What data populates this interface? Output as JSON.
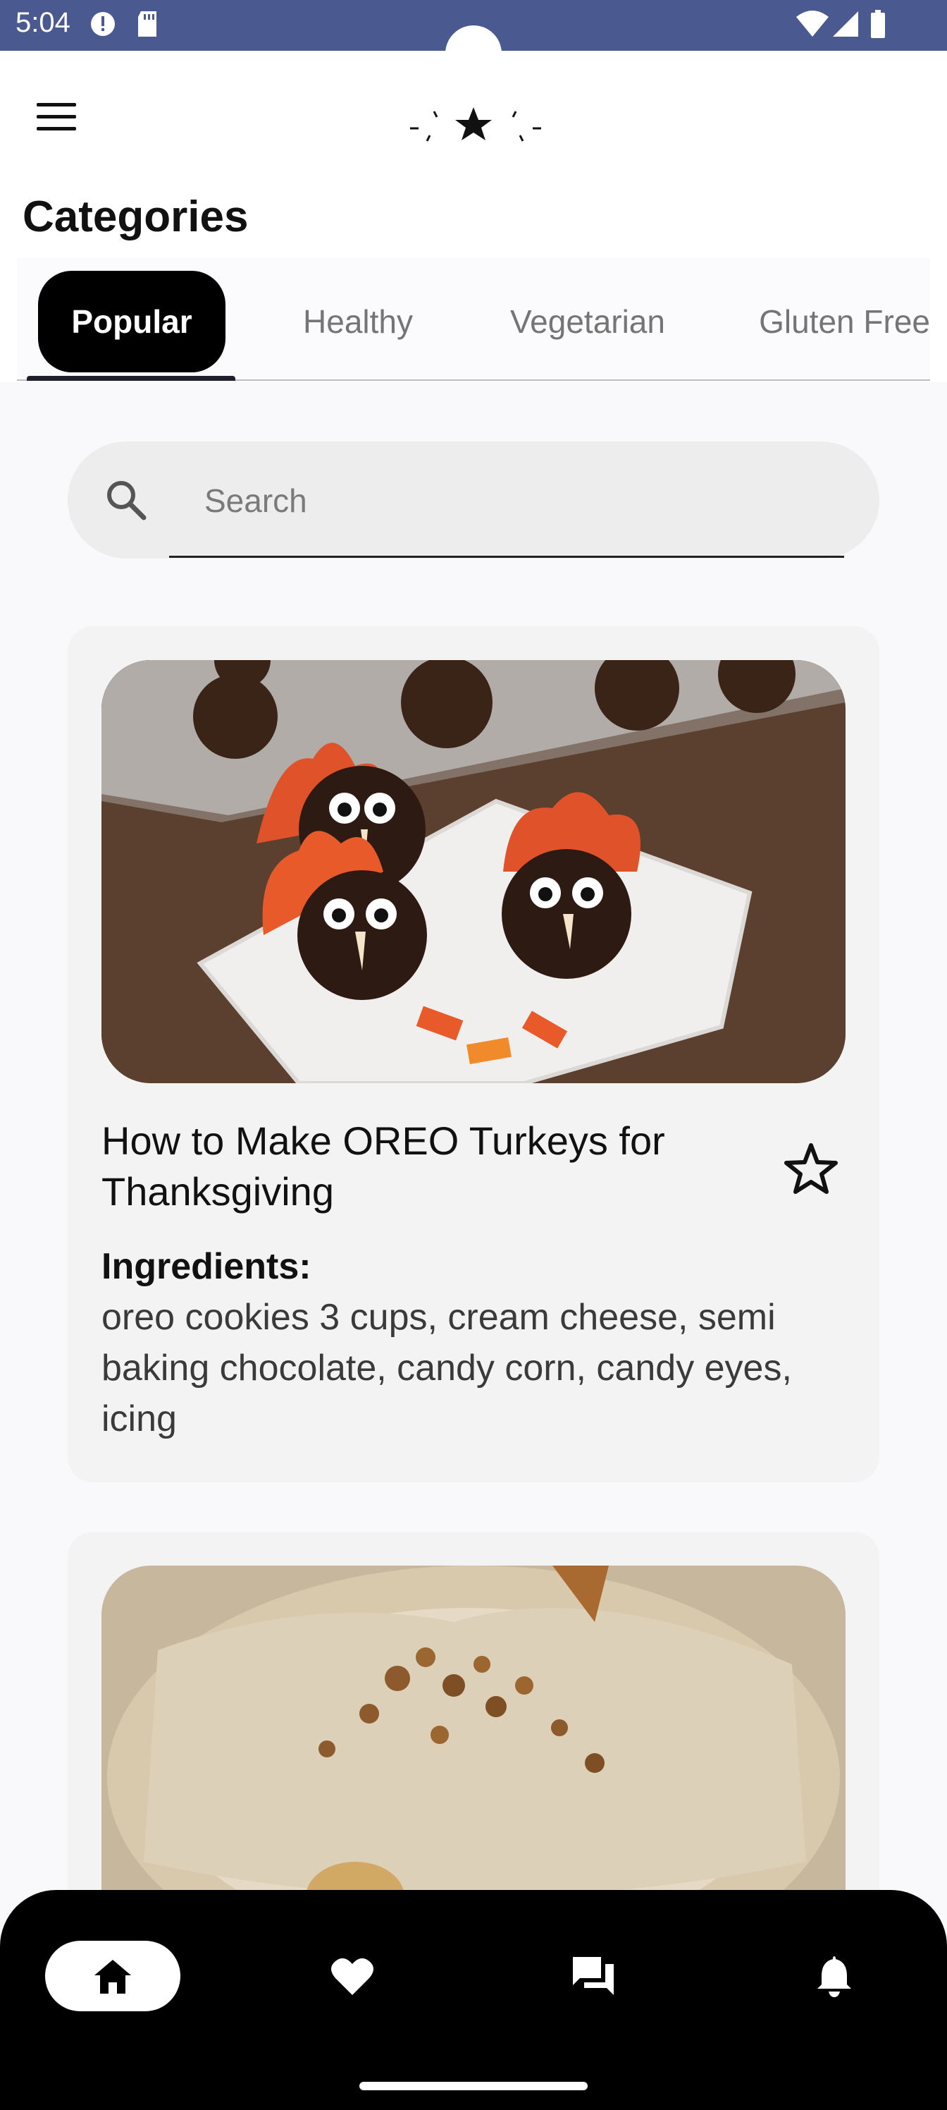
{
  "status_bar": {
    "time": "5:04",
    "icons": [
      "alert-icon",
      "sd-card-icon",
      "wifi-icon",
      "signal-icon",
      "battery-icon"
    ],
    "background": "#4A5A91"
  },
  "header": {
    "menu_icon": "hamburger-menu-icon",
    "logo_icon": "sparkle-star-logo-icon"
  },
  "categories": {
    "title": "Categories",
    "tabs": [
      {
        "label": "Popular",
        "active": true
      },
      {
        "label": "Healthy",
        "active": false
      },
      {
        "label": "Vegetarian",
        "active": false
      },
      {
        "label": "Gluten Free",
        "active": false
      }
    ]
  },
  "search": {
    "placeholder": "Search",
    "value": ""
  },
  "recipes": [
    {
      "title": "How to Make OREO Turkeys for Thanksgiving",
      "ingredients_label": "Ingredients:",
      "ingredients": "oreo cookies 3 cups, cream cheese, semi baking chocolate, candy corn, candy eyes, icing",
      "favorite": false
    },
    {
      "title": "",
      "ingredients_label": "",
      "ingredients": ""
    }
  ],
  "bottom_nav": {
    "items": [
      {
        "icon": "home-icon",
        "active": true
      },
      {
        "icon": "heart-icon",
        "active": false
      },
      {
        "icon": "chat-icon",
        "active": false
      },
      {
        "icon": "bell-icon",
        "active": false
      }
    ]
  },
  "colors": {
    "accent": "#000000",
    "status_bar": "#4A5A91",
    "card_bg": "#F3F3F3"
  }
}
